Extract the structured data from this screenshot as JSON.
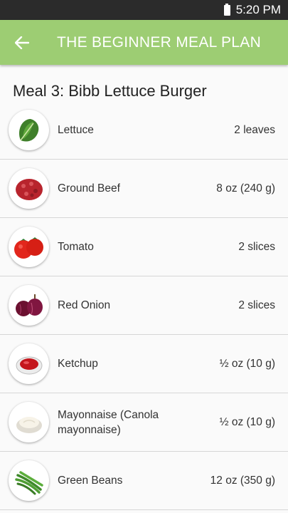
{
  "status_bar": {
    "time": "5:20 PM"
  },
  "app_bar": {
    "title": "THE BEGINNER MEAL PLAN"
  },
  "meal": {
    "title": "Meal 3: Bibb Lettuce Burger"
  },
  "ingredients": [
    {
      "name": "Lettuce",
      "amount": "2 leaves",
      "icon": "lettuce-icon"
    },
    {
      "name": "Ground Beef",
      "amount": "8 oz (240 g)",
      "icon": "ground-beef-icon"
    },
    {
      "name": "Tomato",
      "amount": "2 slices",
      "icon": "tomato-icon"
    },
    {
      "name": "Red Onion",
      "amount": "2 slices",
      "icon": "red-onion-icon"
    },
    {
      "name": "Ketchup",
      "amount": "½ oz (10 g)",
      "icon": "ketchup-icon"
    },
    {
      "name": "Mayonnaise (Canola mayonnaise)",
      "amount": "½ oz (10 g)",
      "icon": "mayonnaise-icon"
    },
    {
      "name": "Green Beans",
      "amount": "12 oz (350 g)",
      "icon": "green-beans-icon"
    }
  ],
  "colors": {
    "app_bar": "#9dcd73",
    "status_bar": "#2b2b2b"
  }
}
